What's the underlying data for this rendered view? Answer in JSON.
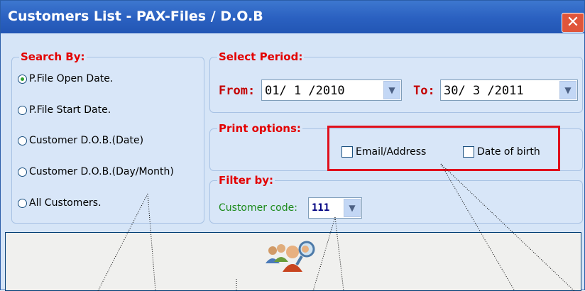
{
  "window": {
    "title": "Customers List - PAX-Files / D.O.B",
    "close_glyph": "✕"
  },
  "search_by": {
    "legend": "Search By:",
    "options": [
      {
        "label": "P.File Open Date.",
        "checked": true
      },
      {
        "label": "P.File Start Date.",
        "checked": false
      },
      {
        "label": "Customer D.O.B.(Date)",
        "checked": false
      },
      {
        "label": "Customer D.O.B.(Day/Month)",
        "checked": false
      },
      {
        "label": "All Customers.",
        "checked": false
      }
    ]
  },
  "select_period": {
    "legend": "Select Period:",
    "from_label": "From:",
    "from_value": "01/ 1 /2010",
    "to_label": "To:",
    "to_value": "30/ 3 /2011"
  },
  "print_options": {
    "legend": "Print options:",
    "email_address_label": "Email/Address",
    "email_address_checked": false,
    "date_of_birth_label": "Date of birth",
    "date_of_birth_checked": false
  },
  "filter_by": {
    "legend": "Filter by:",
    "customer_code_label": "Customer code:",
    "customer_code_value": "111"
  },
  "colors": {
    "title_bar": "#2a60c0",
    "window_bg": "#d6e5f7",
    "legend": "#e30000",
    "highlight_box": "#e0101c",
    "filter_label": "#1c8a1c"
  },
  "icons": {
    "combo_arrow": "chevron-down-icon",
    "print_button_icon": "people-search-icon"
  }
}
